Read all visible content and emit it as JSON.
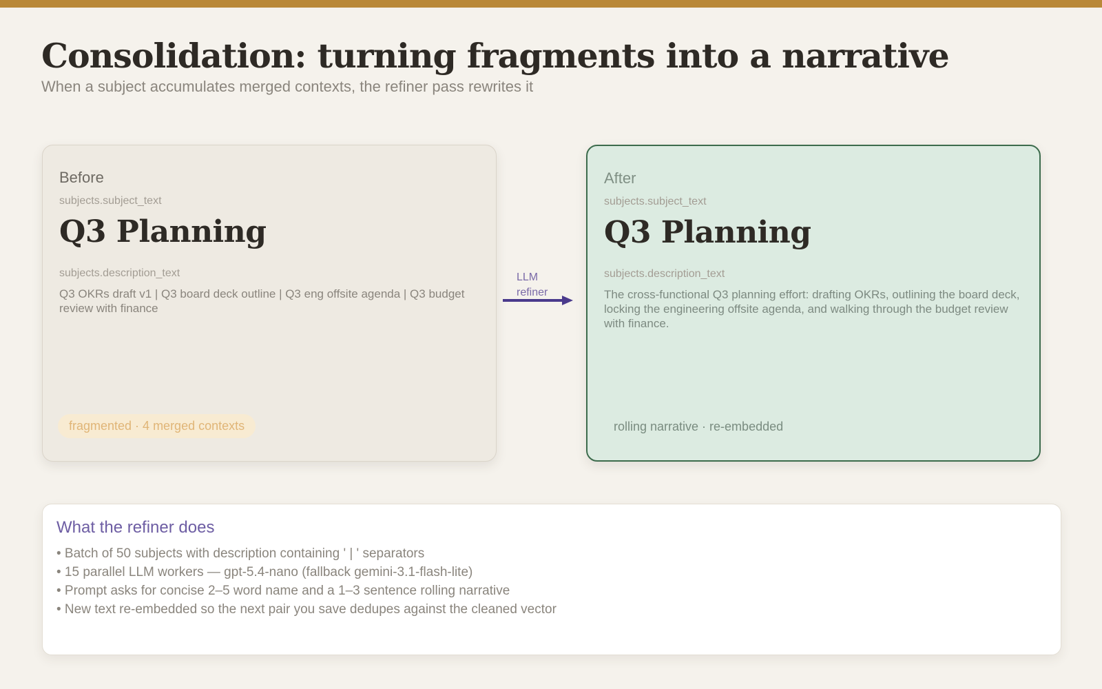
{
  "header": {
    "title": "Consolidation: turning fragments into a narrative",
    "subtitle": "When a subject accumulates merged contexts, the refiner pass rewrites it"
  },
  "before": {
    "label": "Before",
    "subject_field": "subjects.subject_text",
    "subject_text": "Q3 Planning",
    "description_field": "subjects.description_text",
    "description_text": "Q3 OKRs draft v1 | Q3 board deck outline | Q3 eng offsite agenda | Q3 budget review with finance",
    "badge": "fragmented · 4 merged contexts"
  },
  "connector": {
    "label_line1": "LLM",
    "label_line2": "refiner"
  },
  "after": {
    "label": "After",
    "subject_field": "subjects.subject_text",
    "subject_text": "Q3 Planning",
    "description_field": "subjects.description_text",
    "description_text": "The cross-functional Q3 planning effort: drafting OKRs, outlining the board deck, locking the engineering offsite agenda, and walking through the budget review with finance.",
    "badge": "rolling narrative · re-embedded"
  },
  "panel": {
    "title": "What the refiner does",
    "items": [
      "• Batch of 50 subjects with description containing ' | ' separators",
      "• 15 parallel LLM workers — gpt-5.4-nano (fallback gemini-3.1-flash-lite)",
      "• Prompt asks for concise 2–5 word name and a 1–3 sentence rolling narrative",
      "• New text re-embedded so the next pair you save dedupes against the cleaned vector"
    ]
  },
  "colors": {
    "accent_bar": "#b98838",
    "after_border": "#3c6b4c",
    "arrow": "#4a3a8c",
    "badge_before_bg": "#f8ebd2"
  }
}
